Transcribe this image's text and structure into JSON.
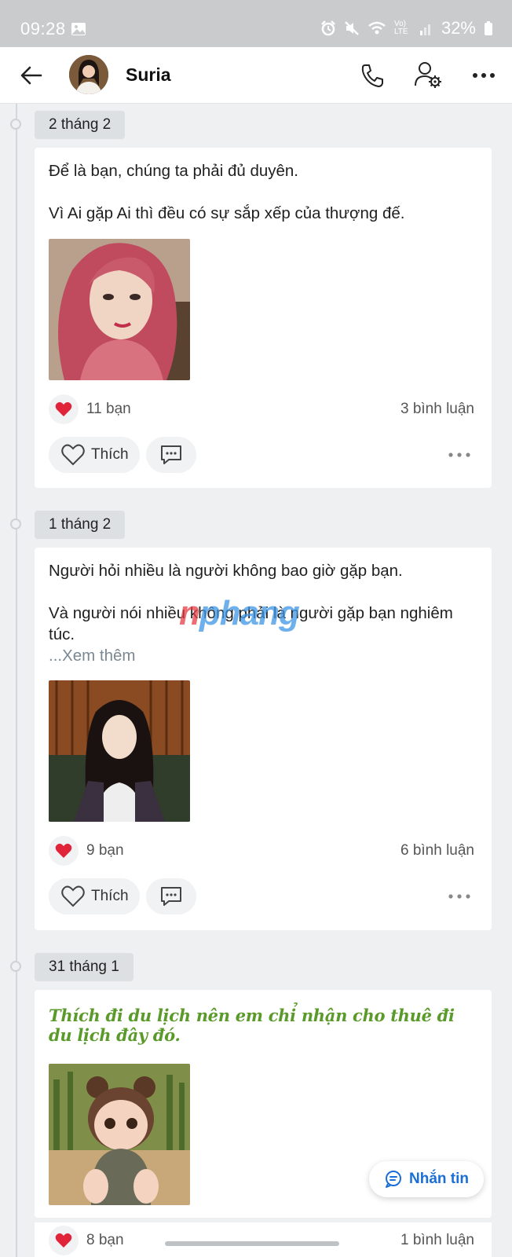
{
  "status_bar": {
    "time": "09:28",
    "battery": "32%",
    "network": "Vo) LTE"
  },
  "header": {
    "contact_name": "Suria",
    "icons": [
      "back-arrow-icon",
      "phone-icon",
      "user-settings-icon",
      "more-icon"
    ]
  },
  "posts": [
    {
      "date": "2 tháng 2",
      "lines": [
        "Để là bạn, chúng ta phải đủ duyên.",
        "Vì Ai gặp Ai thì đều có sự sắp xếp của thượng đế."
      ],
      "likes": "11 bạn",
      "comments": "3 bình luận",
      "like_label": "Thích"
    },
    {
      "date": "1 tháng 2",
      "lines": [
        "Người hỏi nhiều là người không bao giờ gặp bạn.",
        "Và người nói nhiều không phải là người gặp bạn nghiêm túc."
      ],
      "see_more": "...Xem thêm",
      "likes": "9 bạn",
      "comments": "6 bình luận",
      "like_label": "Thích"
    },
    {
      "date": "31 tháng 1",
      "styled_text": "Thích đi du lịch nên em chỉ nhận cho thuê đi du lịch đây đó.",
      "likes": "8 bạn",
      "comments": "1 bình luận"
    }
  ],
  "watermark": {
    "part1": "n",
    "part2": "phang"
  },
  "fab": {
    "label": "Nhắn tin"
  },
  "colors": {
    "accent_blue": "#1a6fd6",
    "green_text": "#5a9a2a",
    "heart_red": "#e0243a"
  }
}
